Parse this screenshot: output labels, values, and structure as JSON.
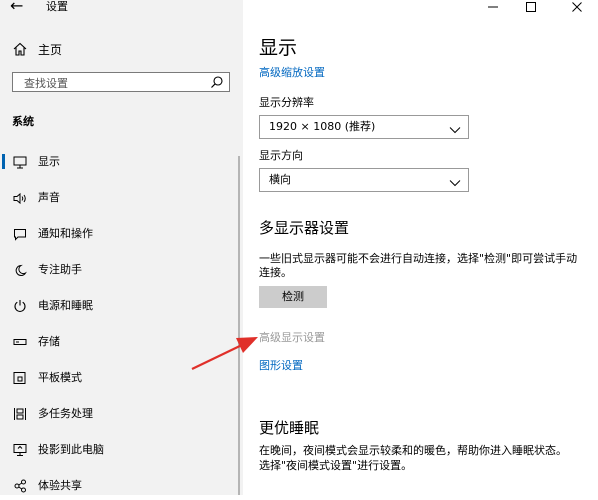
{
  "window": {
    "title": "设置",
    "back": "←",
    "minimize": "—",
    "maximize": "□",
    "close": "✕"
  },
  "sidebar": {
    "home_label": "主页",
    "search_placeholder": "查找设置",
    "section": "系统",
    "items": [
      {
        "label": "显示",
        "icon": "monitor-icon",
        "active": true
      },
      {
        "label": "声音",
        "icon": "speaker-icon"
      },
      {
        "label": "通知和操作",
        "icon": "notification-icon"
      },
      {
        "label": "专注助手",
        "icon": "moon-icon"
      },
      {
        "label": "电源和睡眠",
        "icon": "power-icon"
      },
      {
        "label": "存储",
        "icon": "storage-icon"
      },
      {
        "label": "平板模式",
        "icon": "tablet-icon"
      },
      {
        "label": "多任务处理",
        "icon": "multitask-icon"
      },
      {
        "label": "投影到此电脑",
        "icon": "projector-icon"
      },
      {
        "label": "体验共享",
        "icon": "share-icon"
      }
    ]
  },
  "main": {
    "title": "显示",
    "scaling_link": "高级缩放设置",
    "resolution_label": "显示分辨率",
    "resolution_value": "1920 × 1080 (推荐)",
    "orientation_label": "显示方向",
    "orientation_value": "横向",
    "multi_title": "多显示器设置",
    "multi_desc": "一些旧式显示器可能不会进行自动连接，选择\"检测\"即可尝试手动连接。",
    "detect_button": "检测",
    "advanced_link": "高级显示设置",
    "graphics_link": "图形设置",
    "sleep_title": "更优睡眠",
    "sleep_desc": "在晚间，夜间模式会显示较柔和的暖色，帮助你进入睡眠状态。 选择\"夜间模式设置\"进行设置。"
  },
  "colors": {
    "accent": "#0063b1",
    "link": "#0067c0",
    "annotation_arrow": "#e0302a"
  }
}
